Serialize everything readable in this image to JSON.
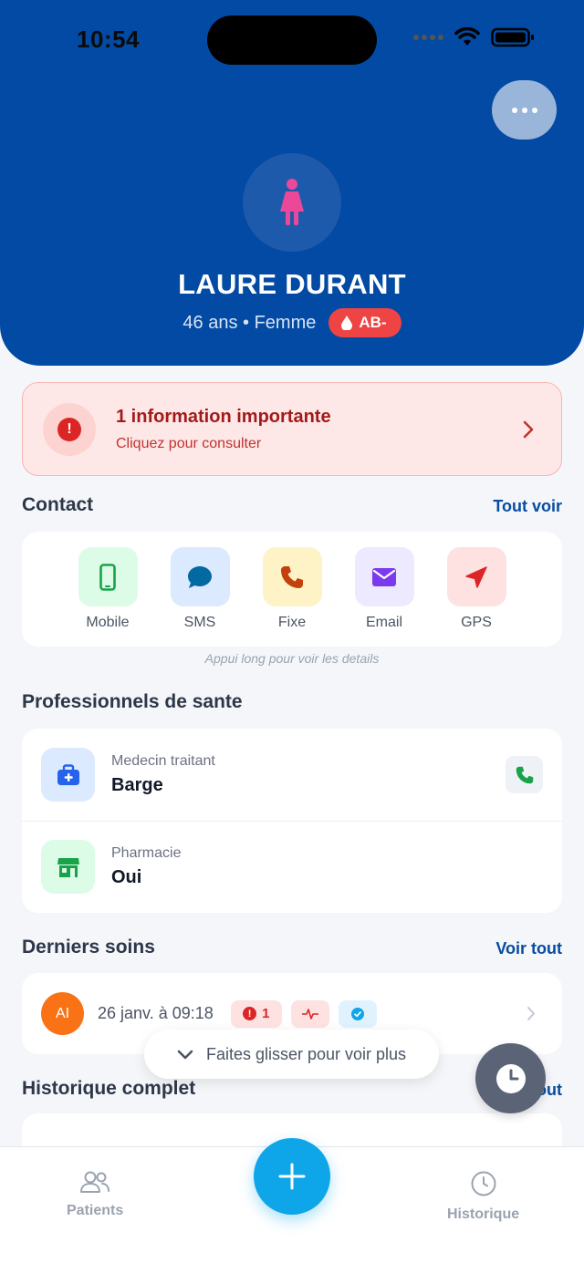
{
  "status_bar": {
    "time": "10:54"
  },
  "patient": {
    "name": "LAURE DURANT",
    "details": "46 ans • Femme",
    "blood_type": "AB-",
    "avatar_icon": "woman-icon",
    "avatar_color": "#ec4899"
  },
  "alert": {
    "title": "1 information importante",
    "subtitle": "Cliquez pour consulter",
    "icon": "exclamation-circle-icon"
  },
  "contact": {
    "title": "Contact",
    "link": "Tout voir",
    "items": [
      {
        "label": "Mobile",
        "icon": "mobile-phone-icon",
        "color": "#16a34a",
        "bg": "#dcfce7"
      },
      {
        "label": "SMS",
        "icon": "chat-bubble-icon",
        "color": "#0369a1",
        "bg": "#dbeafe"
      },
      {
        "label": "Fixe",
        "icon": "phone-icon",
        "color": "#c2410c",
        "bg": "#fef3c7"
      },
      {
        "label": "Email",
        "icon": "envelope-icon",
        "color": "#7c3aed",
        "bg": "#ede9fe"
      },
      {
        "label": "GPS",
        "icon": "navigation-arrow-icon",
        "color": "#dc2626",
        "bg": "#fee2e2"
      }
    ],
    "hint": "Appui long pour voir les details"
  },
  "professionals": {
    "title": "Professionnels de sante",
    "items": [
      {
        "label": "Medecin traitant",
        "value": "Barge",
        "icon": "medical-kit-icon"
      },
      {
        "label": "Pharmacie",
        "value": "Oui",
        "icon": "pharmacy-store-icon"
      }
    ]
  },
  "recent_care": {
    "title": "Derniers soins",
    "link": "Voir tout",
    "item": {
      "initials": "AI",
      "date": "26 janv. à 09:18",
      "alert_count": "1"
    }
  },
  "history": {
    "title": "Historique complet",
    "link": "Tout"
  },
  "toast": {
    "text": "Faites glisser pour voir plus"
  },
  "tabbar": {
    "patients": "Patients",
    "history": "Historique"
  }
}
